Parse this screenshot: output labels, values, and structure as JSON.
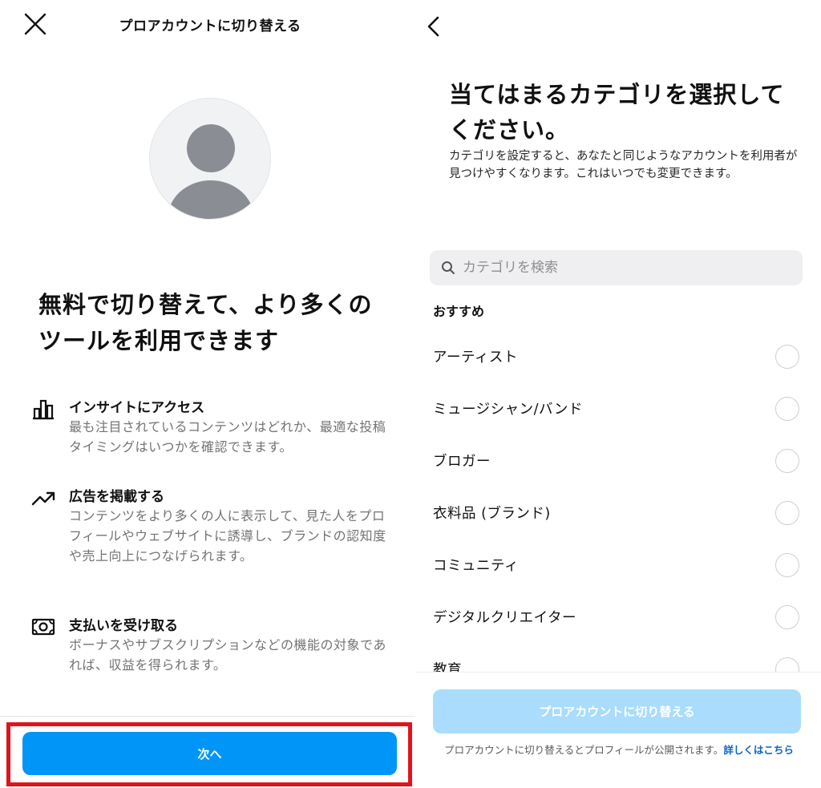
{
  "left": {
    "title": "プロアカウントに切り替える",
    "headline": "無料で切り替えて、より多くのツールを利用できます",
    "features": [
      {
        "icon": "bar-chart-icon",
        "title": "インサイトにアクセス",
        "description": "最も注目されているコンテンツはどれか、最適な投稿タイミングはいつかを確認できます。"
      },
      {
        "icon": "trending-up-icon",
        "title": "広告を掲載する",
        "description": "コンテンツをより多くの人に表示して、見た人をプロフィールやウェブサイトに誘導し、ブランドの認知度や売上向上につなげられます。"
      },
      {
        "icon": "money-icon",
        "title": "支払いを受け取る",
        "description": "ボーナスやサブスクリプションなどの機能の対象であれば、収益を得られます。"
      }
    ],
    "next_button": "次へ"
  },
  "right": {
    "title": "当てはまるカテゴリを選択してください。",
    "subtitle": "カテゴリを設定すると、あなたと同じようなアカウントを利用者が見つけやすくなります。これはいつでも変更できます。",
    "search": {
      "placeholder": "カテゴリを検索",
      "value": ""
    },
    "section_label": "おすすめ",
    "categories": [
      "アーティスト",
      "ミュージシャン/バンド",
      "ブロガー",
      "衣料品 (ブランド)",
      "コミュニティ",
      "デジタルクリエイター",
      "教育"
    ],
    "switch_button": "プロアカウントに切り替える",
    "footer_note": "プロアカウントに切り替えるとプロフィールが公開されます。",
    "learn_more": "詳しくはこちら"
  },
  "colors": {
    "primary_blue": "#0095f6",
    "disabled_blue": "#a9dcfd",
    "link_blue": "#0a66c2",
    "highlight_red": "#e0141b",
    "secondary_text": "#737373"
  }
}
